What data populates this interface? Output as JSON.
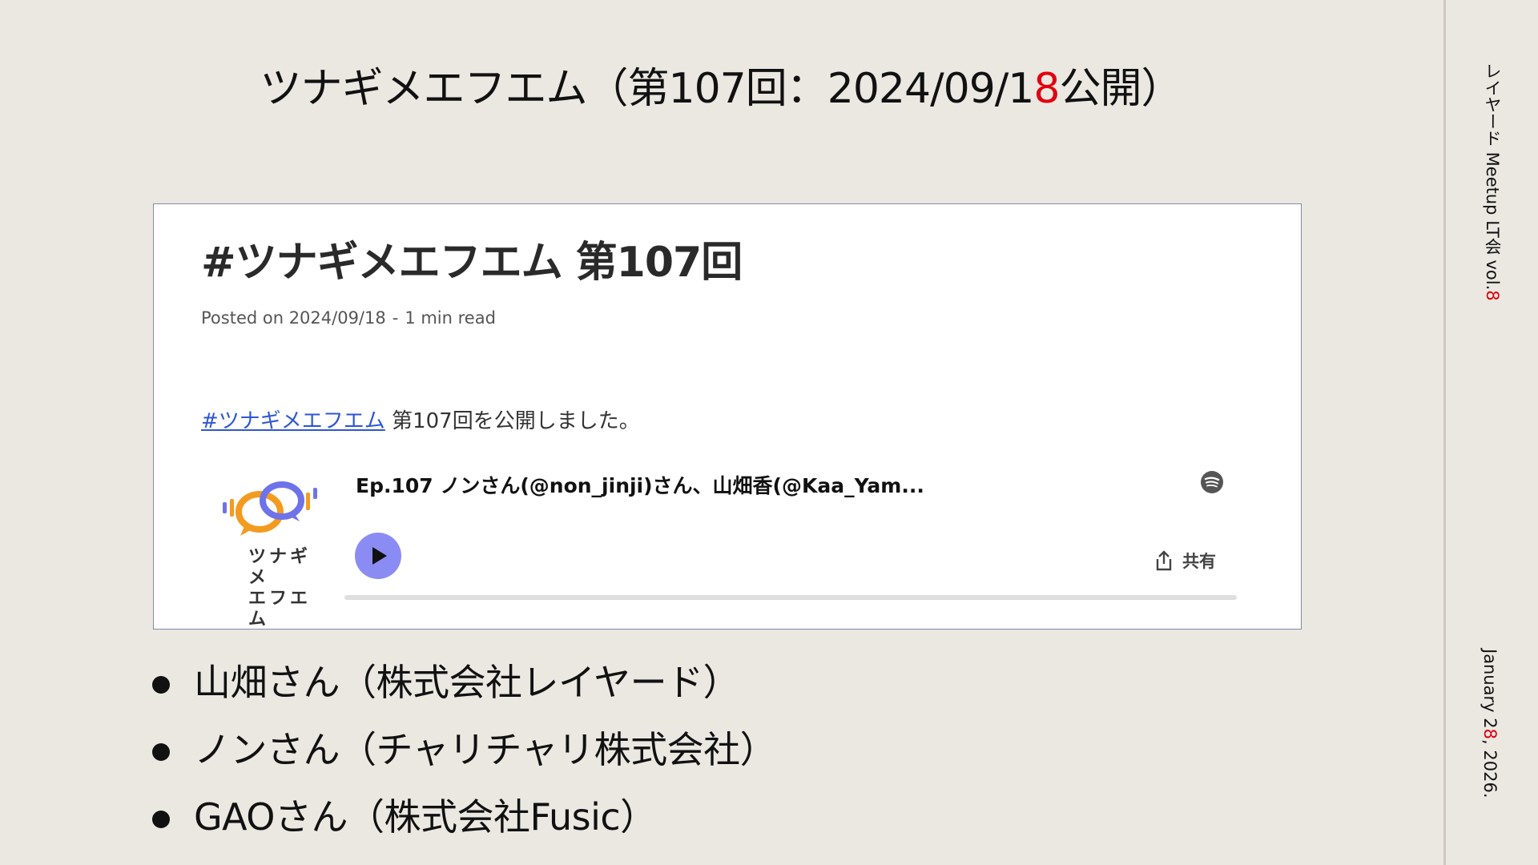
{
  "slide": {
    "title_before": "ツナギメエフエム（第107回：2024/09/1",
    "title_accent": "8",
    "title_after": "公開）"
  },
  "sidebar": {
    "event_before": "レイヤード Meetup LT会 vol.",
    "event_accent": "8",
    "date_before": "January 2",
    "date_accent": "8",
    "date_after": ", 2026."
  },
  "post": {
    "title": "#ツナギメエフエム 第107回",
    "posted_on": "Posted on 2024/09/18",
    "separator": "-",
    "read_time": "1 min read",
    "hashtag_link": "#ツナギメエフエム",
    "body_text": " 第107回を公開しました。"
  },
  "player": {
    "logo_line1": "ツナギメ",
    "logo_line2": "エフエム",
    "episode_title": "Ep.107 ノンさん(@non_jinji)さん、山畑香(@Kaa_Yam...",
    "share_label": "共有",
    "progress": 0
  },
  "bullets": [
    "山畑さん（株式会社レイヤード）",
    "ノンさん（チャリチャリ株式会社）",
    "GAOさん（株式会社Fusic）"
  ],
  "colors": {
    "background": "#ebe8e2",
    "accent": "#e2000f",
    "link": "#2f56d6",
    "play_button": "#8b8cf3"
  }
}
